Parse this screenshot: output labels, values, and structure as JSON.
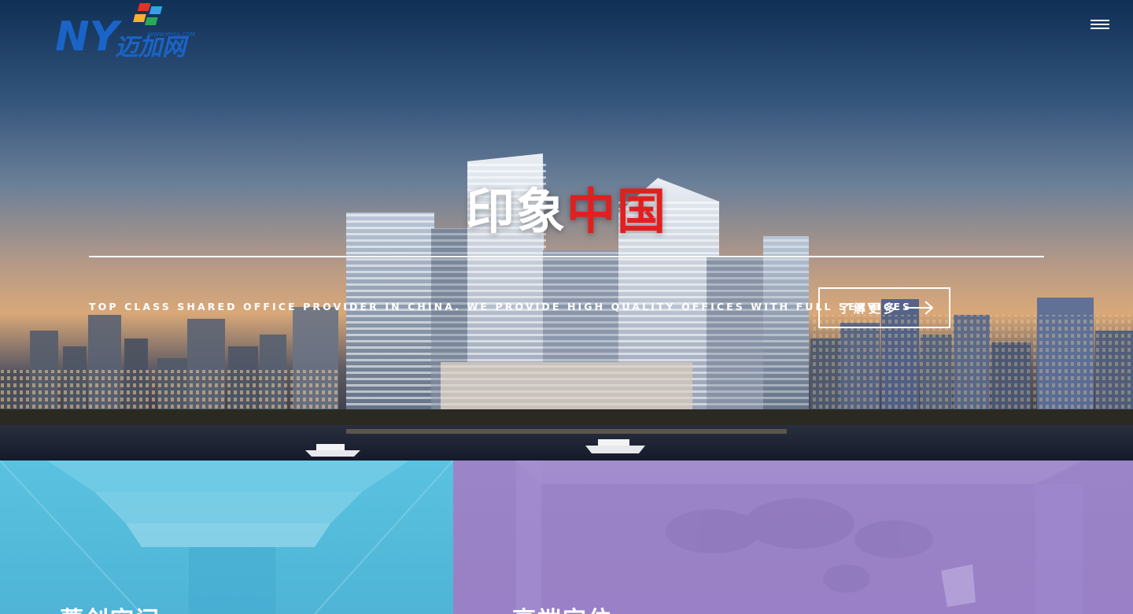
{
  "header": {
    "logo_text": "迈加网",
    "logo_url_text": "WWW.MYJIA.COM",
    "menu_icon": "hamburger-menu-icon"
  },
  "hero": {
    "title_white": "印象",
    "title_red": "中国",
    "subtitle": "TOP CLASS SHARED OFFICE PROVIDER IN CHINA. WE PROVIDE HIGH QUALITY OFFICES WITH FULL SERVICES",
    "more_button_label": "了解更多",
    "more_button_icon": "arrow-right-icon"
  },
  "panels": [
    {
      "title": "菁创空间",
      "color": "#58bfe0"
    },
    {
      "title": "高端定位",
      "color": "#9b84c8"
    }
  ],
  "colors": {
    "accent_red": "#e21f1f",
    "logo_blue": "#1a64c8"
  }
}
